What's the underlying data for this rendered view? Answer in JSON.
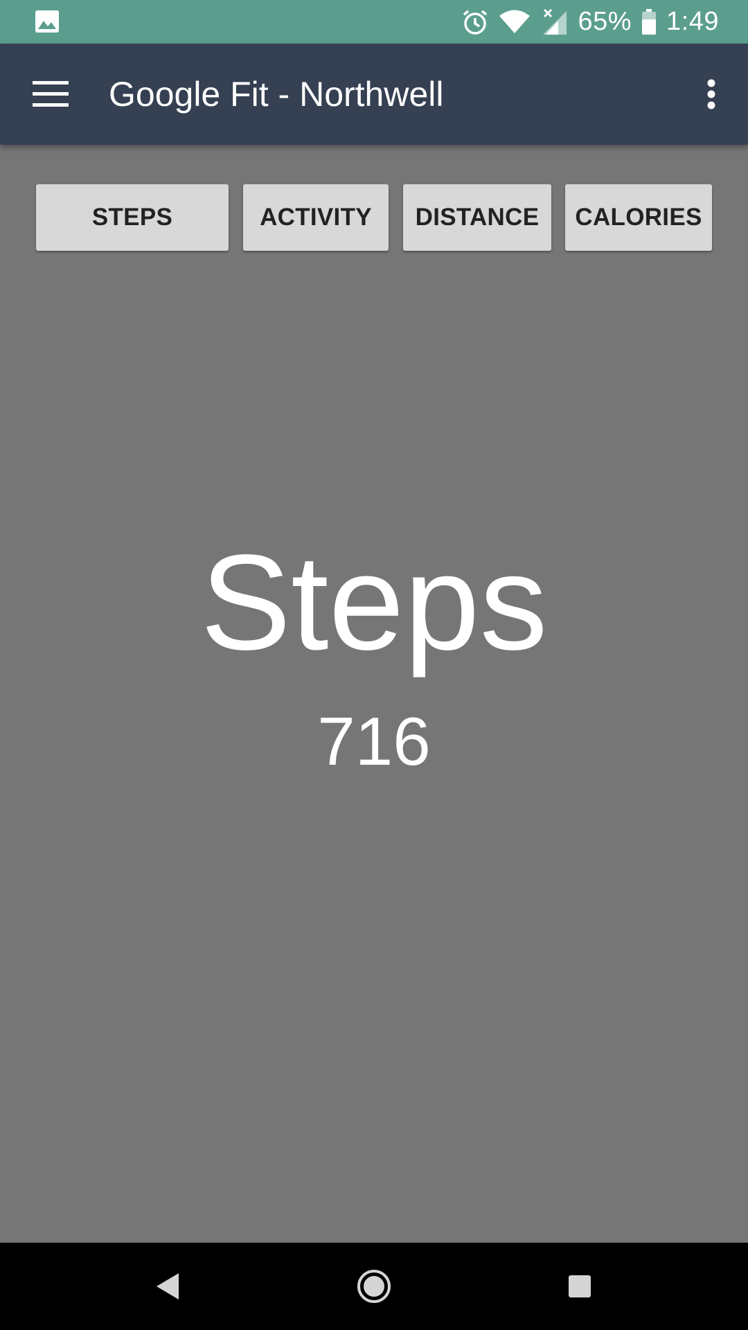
{
  "status_bar": {
    "left_icons": [
      "gallery-icon"
    ],
    "right_icons": [
      "alarm-icon",
      "wifi-icon",
      "cell-signal-icon",
      "battery-icon"
    ],
    "battery_percent": "65%",
    "time": "1:49",
    "background_color": "#5b9e8e"
  },
  "app_bar": {
    "title": "Google Fit - Northwell",
    "menu_icon": "hamburger-menu-icon",
    "overflow_icon": "more-vert-icon",
    "background_color": "#354052"
  },
  "tabs": [
    {
      "label": "STEPS"
    },
    {
      "label": "ACTIVITY"
    },
    {
      "label": "DISTANCE"
    },
    {
      "label": "CALORIES"
    }
  ],
  "main": {
    "metric_title": "Steps",
    "metric_value": "716",
    "background_color": "#767676"
  },
  "nav_bar": {
    "icons": [
      "back-icon",
      "home-icon",
      "recents-icon"
    ]
  }
}
